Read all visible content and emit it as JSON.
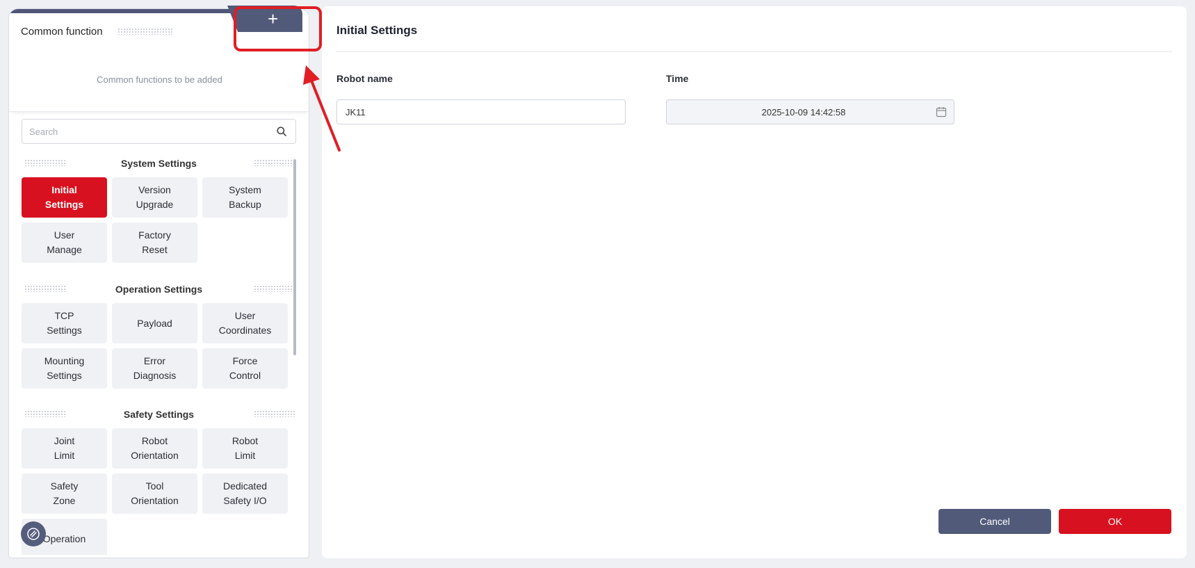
{
  "common_function": {
    "title": "Common function",
    "add_label": "+",
    "empty_text": "Common functions to be added"
  },
  "search": {
    "placeholder": "Search",
    "value": ""
  },
  "menu": {
    "sections": [
      {
        "title": "System Settings",
        "items": [
          "Initial\nSettings",
          "Version\nUpgrade",
          "System\nBackup",
          "User\nManage",
          "Factory\nReset"
        ]
      },
      {
        "title": "Operation Settings",
        "items": [
          "TCP\nSettings",
          "Payload",
          "User\nCoordinates",
          "Mounting\nSettings",
          "Error\nDiagnosis",
          "Force\nControl"
        ]
      },
      {
        "title": "Safety Settings",
        "items": [
          "Joint\nLimit",
          "Robot\nOrientation",
          "Robot\nLimit",
          "Safety\nZone",
          "Tool\nOrientation",
          "Dedicated\nSafety I/O",
          "Operation"
        ]
      }
    ],
    "active_item": "Initial Settings"
  },
  "main": {
    "title": "Initial Settings",
    "robot_name_label": "Robot name",
    "robot_name_value": "JK11",
    "time_label": "Time",
    "time_value": "2025-10-09 14:42:58",
    "cancel_label": "Cancel",
    "ok_label": "OK"
  },
  "colors": {
    "accent": "#d7111f",
    "secondary": "#525a7a",
    "annotation": "#e01e24"
  },
  "icons": {
    "search": "search-icon",
    "calendar": "calendar-icon",
    "float": "link-icon"
  }
}
